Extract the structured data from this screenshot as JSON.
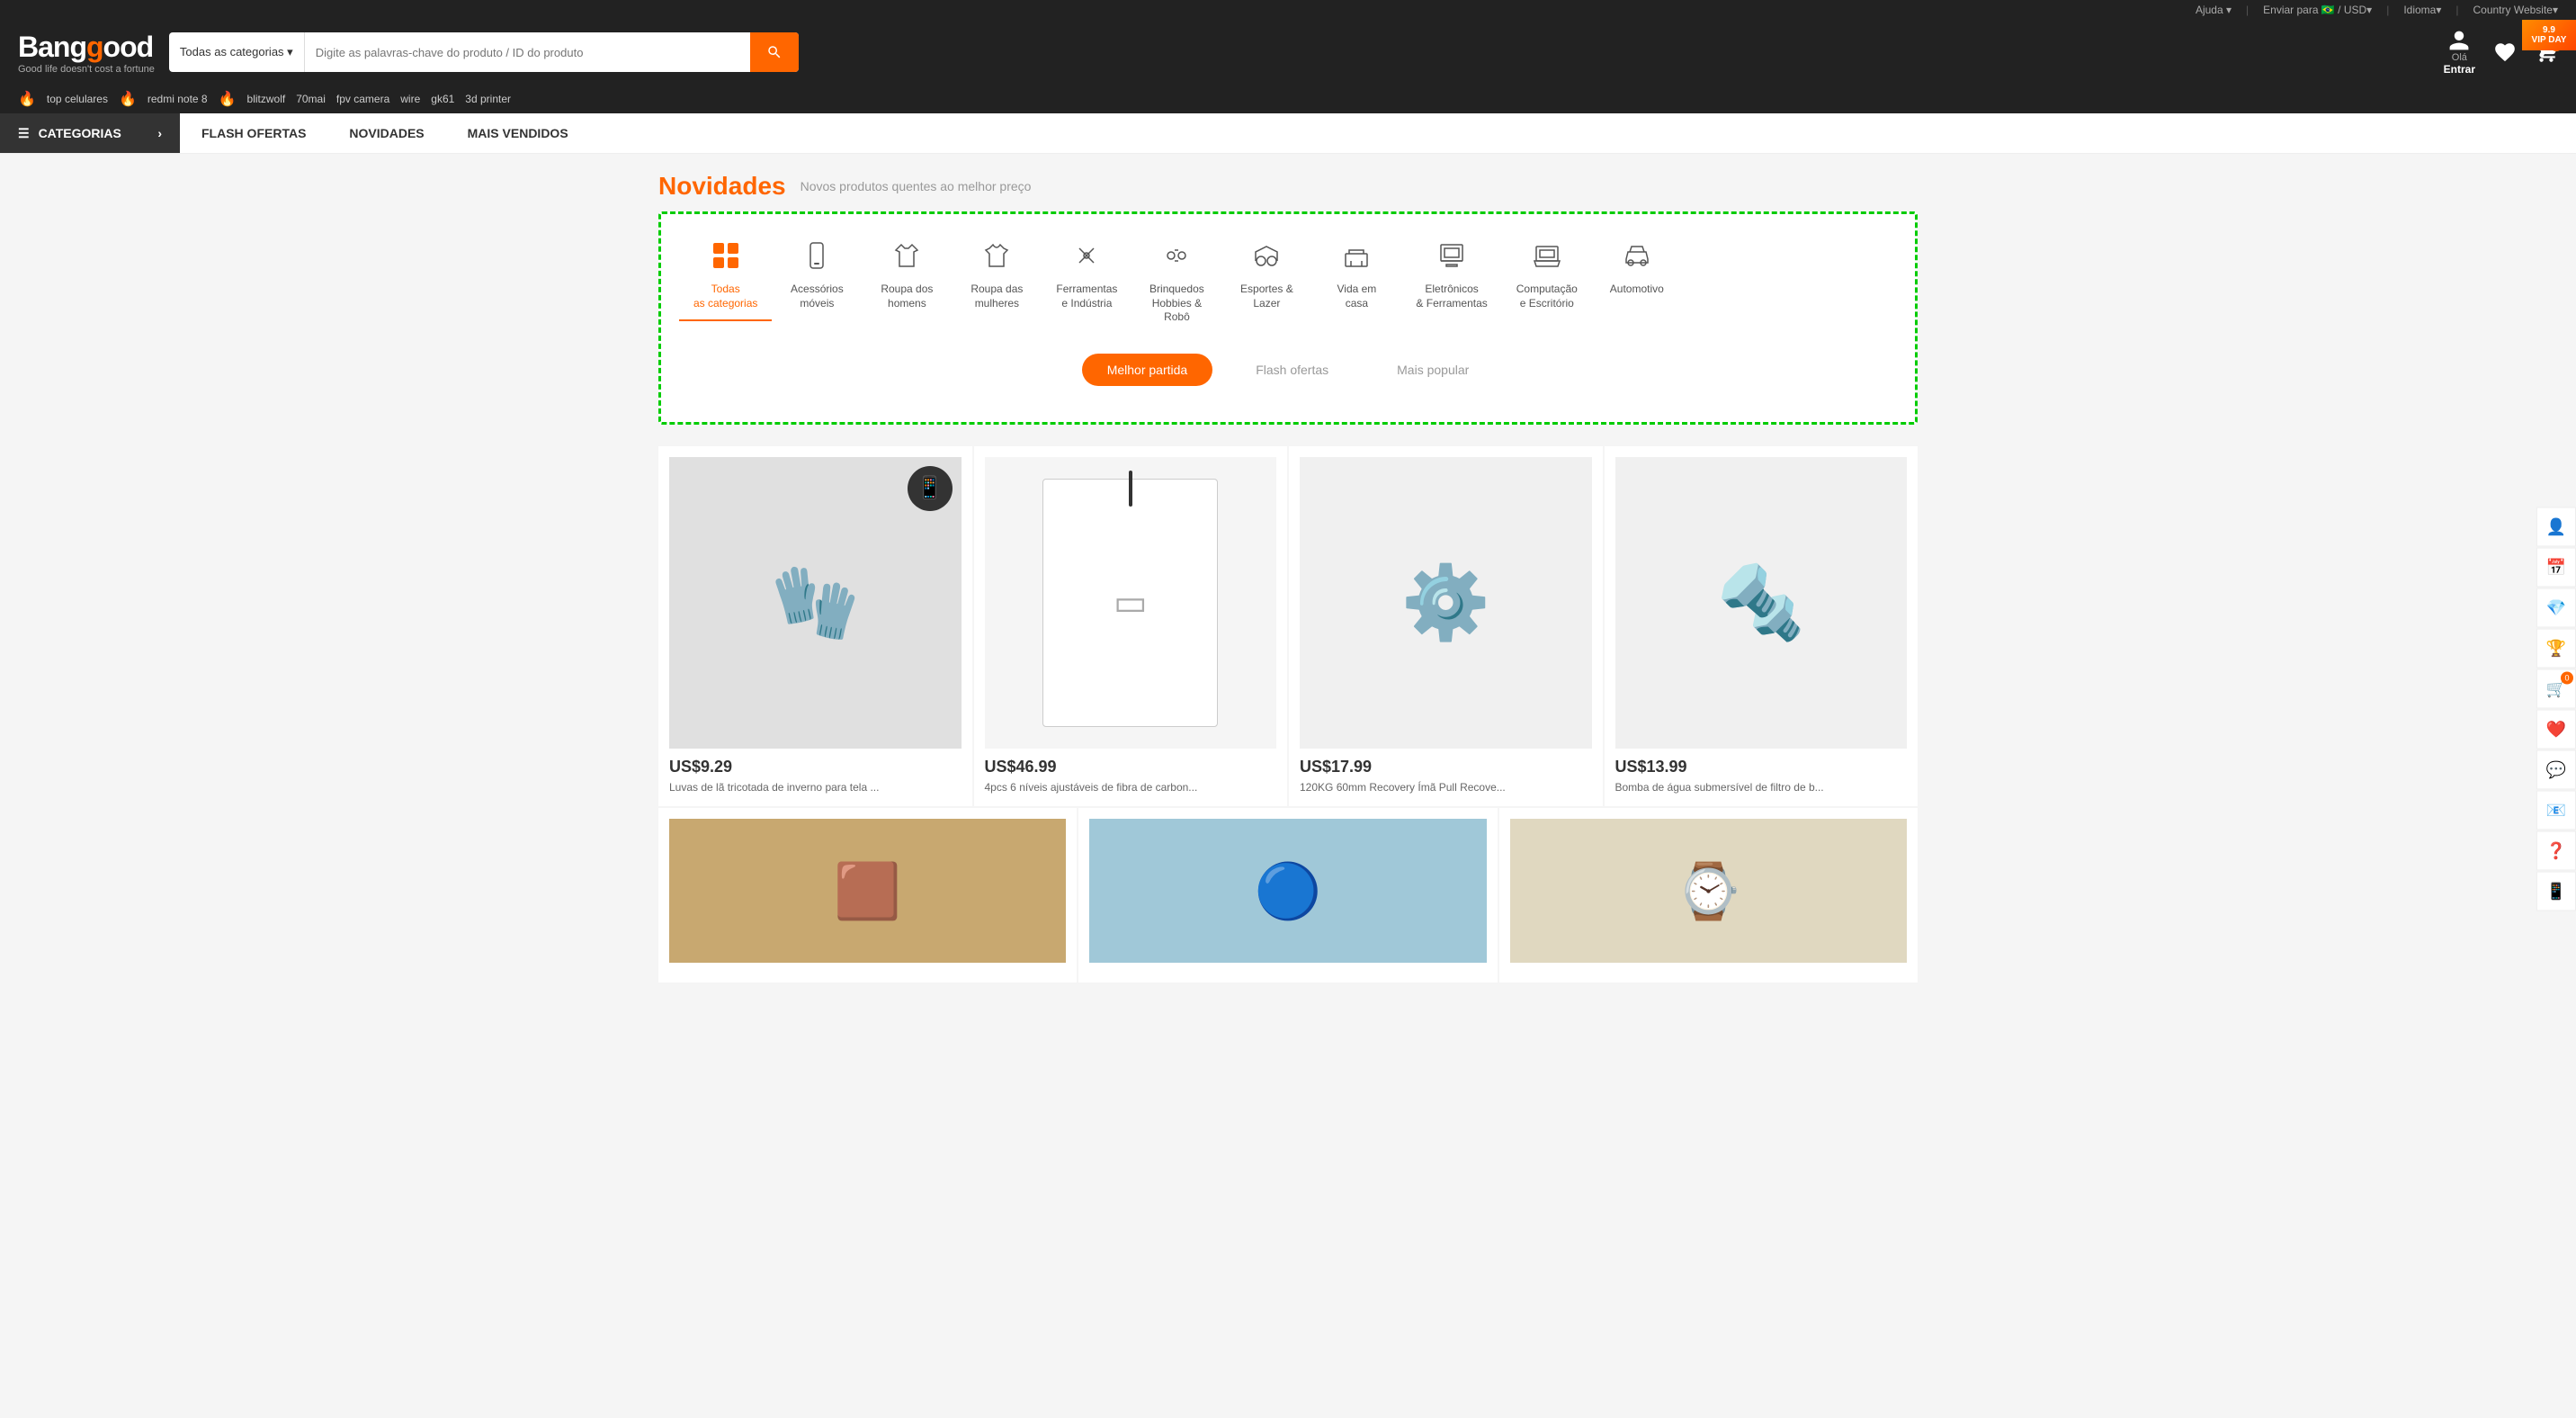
{
  "topbar": {
    "help": "Ajuda ▾",
    "send_to": "Enviar para",
    "currency": "/ USD▾",
    "language": "Idioma▾",
    "country": "Country Website▾",
    "flag_emoji": "🇧🇷"
  },
  "header": {
    "logo_main": "Bangg",
    "logo_accent": "o",
    "logo_end": "od",
    "logo_tagline": "Good life doesn't cost a fortune",
    "search_category": "Todas as categorias ▾",
    "search_placeholder": "Digite as palavras-chave do produto / ID do produto",
    "user_greeting": "Olá",
    "user_action": "Entrar",
    "cart_count": "0",
    "vip_label": "9.9\nVIP DAY"
  },
  "search_tags": [
    "top celulares",
    "redmi note 8",
    "blitzwolf",
    "70mai",
    "fpv camera",
    "wire",
    "gk61",
    "3d printer"
  ],
  "nav": {
    "categories_label": "CATEGORIAS",
    "links": [
      "FLASH OFERTAS",
      "NOVIDADES",
      "MAIS VENDIDOS"
    ]
  },
  "section": {
    "title": "Novidades",
    "subtitle": "Novos produtos quentes ao melhor preço"
  },
  "categories": [
    {
      "id": "todas",
      "label": "Todas\nas categorias",
      "icon": "⊞",
      "active": true
    },
    {
      "id": "acessorios",
      "label": "Acessórios\nmóveis",
      "icon": "📱",
      "active": false
    },
    {
      "id": "roupa-homens",
      "label": "Roupa dos\nhomens",
      "icon": "👕",
      "active": false
    },
    {
      "id": "roupa-mulheres",
      "label": "Roupa das\nmulheres",
      "icon": "👗",
      "active": false
    },
    {
      "id": "ferramentas",
      "label": "Ferramentas\ne Indústria",
      "icon": "🔧",
      "active": false
    },
    {
      "id": "brinquedos",
      "label": "Brinquedos\nHobbies &\nRobô",
      "icon": "🤖",
      "active": false
    },
    {
      "id": "esportes",
      "label": "Esportes &\nLazer",
      "icon": "🚲",
      "active": false
    },
    {
      "id": "vida-casa",
      "label": "Vida em\ncasa",
      "icon": "🛋️",
      "active": false
    },
    {
      "id": "eletronicos",
      "label": "Eletrônicos\n& Ferramentas",
      "icon": "💡",
      "active": false
    },
    {
      "id": "computacao",
      "label": "Computação\ne Escritório",
      "icon": "💻",
      "active": false
    },
    {
      "id": "automotivo",
      "label": "Automotivo",
      "icon": "🚗",
      "active": false
    }
  ],
  "tabs": [
    {
      "id": "melhor",
      "label": "Melhor partida",
      "active": true
    },
    {
      "id": "flash",
      "label": "Flash ofertas",
      "active": false
    },
    {
      "id": "popular",
      "label": "Mais popular",
      "active": false
    }
  ],
  "products": [
    {
      "price": "US$9.29",
      "name": "Luvas de lã tricotada de inverno para tela ...",
      "icon": "🧤",
      "bg": "#e8e8e8"
    },
    {
      "price": "US$46.99",
      "name": "4pcs 6 níveis ajustáveis de fibra de carbon...",
      "icon": "⬛",
      "bg": "#f0f0f0"
    },
    {
      "price": "US$17.99",
      "name": "120KG 60mm Recovery Ímã Pull Recove...",
      "icon": "🔩",
      "bg": "#e5e5e5"
    },
    {
      "price": "US$13.99",
      "name": "Bomba de água submersível de filtro de b...",
      "icon": "🔧",
      "bg": "#e0e0e0"
    }
  ],
  "bottom_products": [
    {
      "price": "",
      "name": "",
      "icon": "🟫",
      "bg": "#d8c0a0"
    },
    {
      "price": "",
      "name": "",
      "icon": "🔵",
      "bg": "#b0d4e0"
    },
    {
      "price": "",
      "name": "",
      "icon": "⌚",
      "bg": "#e0e0e0"
    }
  ],
  "sidebar": {
    "icons": [
      "👤",
      "📅",
      "💎",
      "🏆",
      "🛒",
      "❤️",
      "💬",
      "📧",
      "❓",
      "📱"
    ]
  }
}
